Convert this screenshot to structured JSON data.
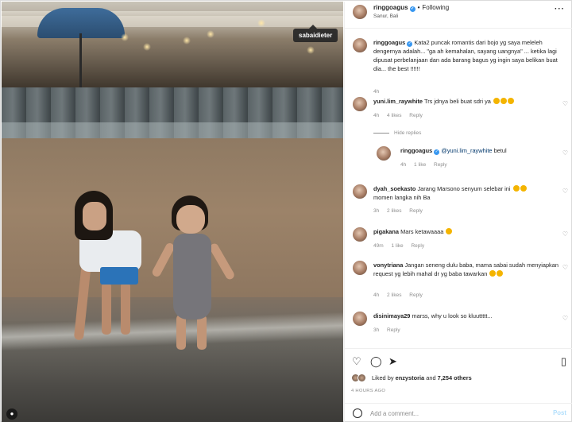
{
  "photo": {
    "tag_label": "sabaidieter"
  },
  "header": {
    "username": "ringgoagus",
    "follow_label": "Following",
    "location": "Sanur, Bali",
    "more_icon": "more-options-icon"
  },
  "caption": {
    "username": "ringgoagus",
    "text": "Kata2 puncak romantis dari bojo yg saya meleleh dengernya adalah... \"ga ah kemahalan, sayang uangnya\" ... ketika lagi dipusat perbelanjaan dan ada barang bagus yg ingin saya belikan buat dia... the best !!!!!!",
    "time": "4h"
  },
  "comments": [
    {
      "username": "yuni.lim_raywhite",
      "text": "Trs jdnya beli buat sdri ya",
      "time": "4h",
      "likes": "4 likes",
      "reply": "Reply",
      "hide_replies": "Hide replies",
      "replies": [
        {
          "username": "ringgoagus",
          "mention": "@yuni.lim_raywhite",
          "text": "betul",
          "time": "4h",
          "likes": "1 like",
          "reply": "Reply"
        }
      ]
    },
    {
      "username": "dyah_soekasto",
      "text": "Jarang Marsono senyum selebar ini",
      "text2": "momen langka nih Ba",
      "time": "3h",
      "likes": "2 likes",
      "reply": "Reply"
    },
    {
      "username": "pigakana",
      "text": "Mars ketawaaaa",
      "time": "49m",
      "likes": "1 like",
      "reply": "Reply"
    },
    {
      "username": "vonytriana",
      "text": "Jangan seneng dulu baba, mama sabai sudah menyiapkan request yg lebih mahal dr yg baba tawarkan",
      "time": "4h",
      "likes": "2 likes",
      "reply": "Reply"
    },
    {
      "username": "disinimaya29",
      "text": "marss, why u look so kluuttttt...",
      "time": "3h",
      "reply": "Reply"
    }
  ],
  "likes": {
    "prefix": "Liked by",
    "user": "enzystoria",
    "and": "and",
    "others": "7,254 others"
  },
  "post_time": "4 HOURS AGO",
  "add_comment": {
    "placeholder": "Add a comment...",
    "post_label": "Post"
  }
}
